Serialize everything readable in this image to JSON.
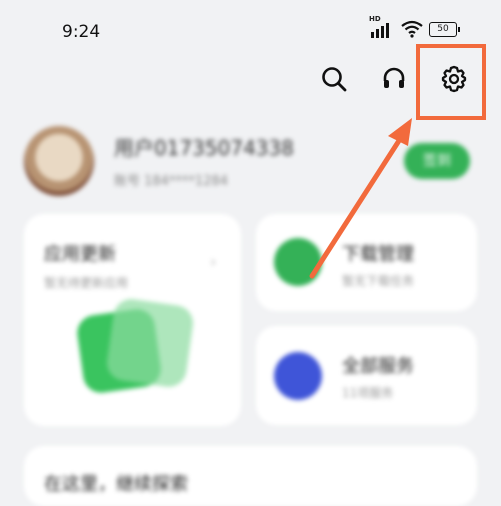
{
  "status_bar": {
    "time": "9:24",
    "network": "HD",
    "battery": "50"
  },
  "toolbar": {
    "icons": [
      "search-icon",
      "headset-icon",
      "gear-icon"
    ]
  },
  "profile": {
    "username": "用户01735074338",
    "account": "账号 184****1284",
    "signin_label": "签到"
  },
  "cards": {
    "update": {
      "title": "应用更新",
      "subtitle": "暂无待更新应用"
    },
    "download": {
      "title": "下载管理",
      "subtitle": "暂无下载任务"
    },
    "services": {
      "title": "全部服务",
      "subtitle": "11项服务"
    },
    "bottom": {
      "title": "在这里，继续探索"
    }
  },
  "colors": {
    "highlight": "#f26a3c",
    "accent_green": "#34b157",
    "services_blue": "#3f55d8",
    "background": "#f1f2f4"
  }
}
